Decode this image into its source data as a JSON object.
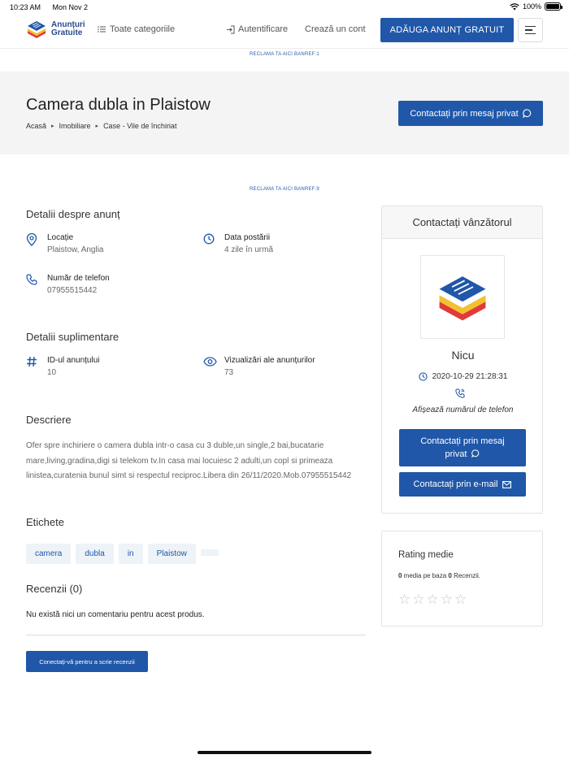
{
  "status": {
    "time": "10:23 AM",
    "date": "Mon Nov 2",
    "battery": "100%"
  },
  "header": {
    "logo_line1": "Anunțuri",
    "logo_line2": "Gratuite",
    "all_categories": "Toate categoriile",
    "login": "Autentificare",
    "create_account": "Crează un cont",
    "add_ad": "ADĂUGA ANUNȚ GRATUIT"
  },
  "ads": {
    "top": "RECLAMA TA AICI BANREF:1",
    "middle": "RECLAMA TA AICI BANREF:9"
  },
  "hero": {
    "title": "Camera dubla in Plaistow",
    "breadcrumb": [
      "Acasă",
      "Imobiliare",
      "Case - Vile de închiriat"
    ],
    "contact_button": "Contactați prin mesaj privat"
  },
  "details": {
    "title": "Detalii despre anunț",
    "location_label": "Locație",
    "location_value": "Plaistow, Anglia",
    "posted_label": "Data postării",
    "posted_value": "4 zile în urmă",
    "phone_label": "Număr de telefon",
    "phone_value": "07955515442"
  },
  "extra": {
    "title": "Detalii suplimentare",
    "id_label": "ID-ul anunțului",
    "id_value": "10",
    "views_label": "Vizualizări ale anunțurilor",
    "views_value": "73"
  },
  "description": {
    "title": "Descriere",
    "text": "Ofer spre inchiriere o camera dubla intr-o casa cu 3 duble,un single,2 bai,bucatarie mare,living,gradina,digi si telekom tv.In casa mai locuiesc 2 adulti,un copl si primeaza linistea,curatenia bunul simt si respectul reciproc.Libera din 26/11/2020.Mob.07955515442"
  },
  "tags": {
    "title": "Etichete",
    "items": [
      "camera",
      "dubla",
      "in",
      "Plaistow"
    ]
  },
  "reviews": {
    "title": "Recenzii (0)",
    "empty": "Nu există nici un comentariu pentru acest produs.",
    "write_button": "Conectați-vă pentru a scrie recenzii"
  },
  "seller": {
    "card_title": "Contactați vânzătorul",
    "name": "Nicu",
    "date": "2020-10-29 21:28:31",
    "show_phone": "Afișează numărul de telefon",
    "message_button": "Contactați prin mesaj privat",
    "email_button": "Contactați prin e-mail"
  },
  "rating": {
    "title": "Rating medie",
    "average": "0",
    "text_mid": " media pe baza ",
    "count": "0",
    "text_end": " Recenzii.",
    "stars_filled": 0,
    "stars_total": 5
  },
  "colors": {
    "primary": "#2057a8",
    "hero_bg": "#f4f4f5",
    "logo_red": "#e03a3a",
    "logo_yellow": "#f2c12e"
  }
}
